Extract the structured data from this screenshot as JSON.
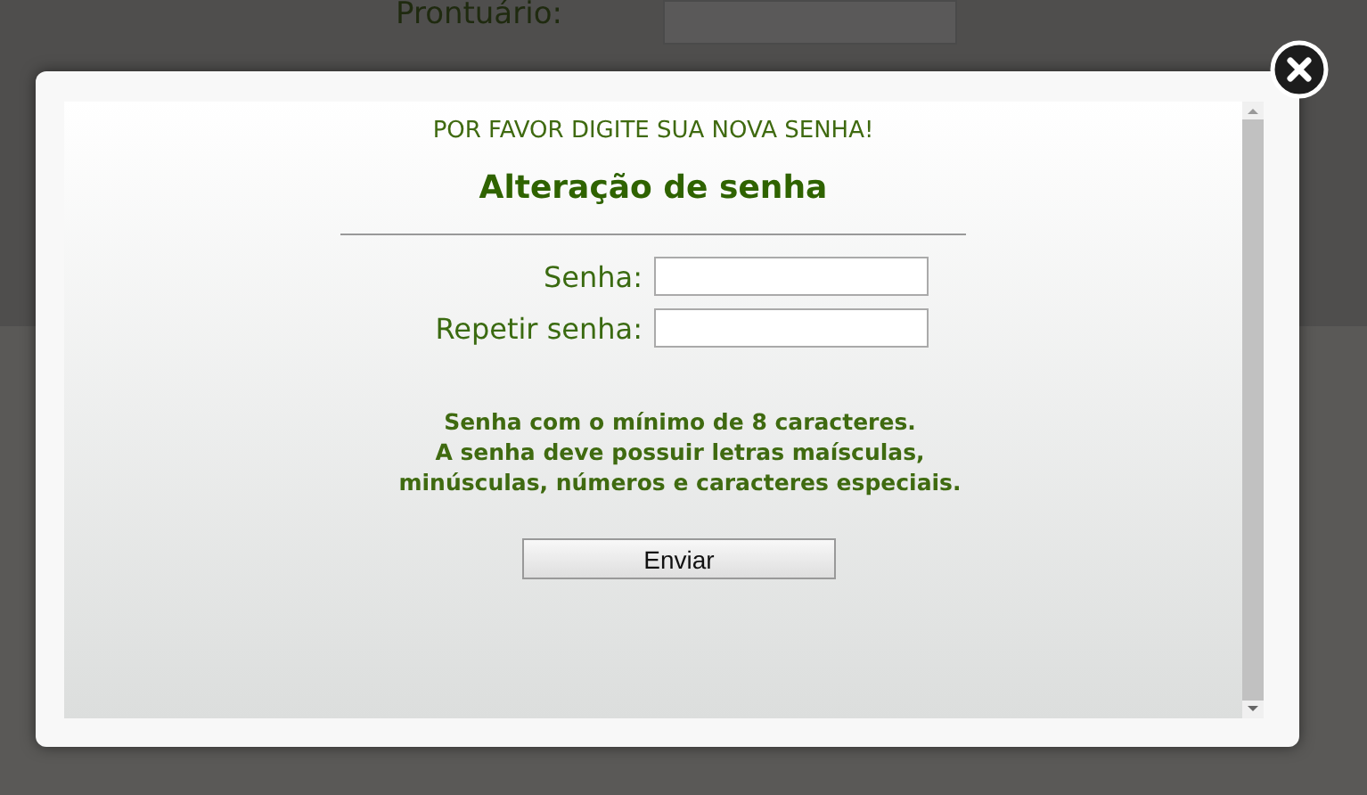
{
  "background": {
    "label": "Prontuário:"
  },
  "dialog": {
    "notice": "POR FAVOR DIGITE SUA NOVA SENHA!",
    "title": "Alteração de senha",
    "fields": [
      {
        "label": "Senha:"
      },
      {
        "label": "Repetir senha:"
      }
    ],
    "hint_lines": [
      "Senha com o mínimo de 8 caracteres.",
      "A senha deve possuir letras maísculas,",
      "minúsculas, números e caracteres especiais."
    ],
    "submit": "Enviar"
  }
}
